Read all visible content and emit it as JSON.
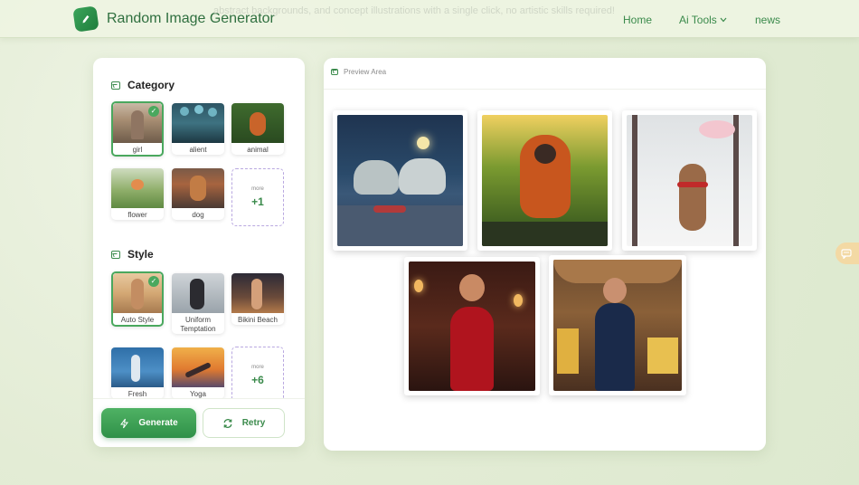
{
  "header": {
    "brand": "Random Image Generator",
    "tagline": "abstract backgrounds, and concept illustrations with a single click, no artistic skills required!",
    "nav": {
      "home": "Home",
      "ai_tools": "Ai Tools",
      "news": "news"
    }
  },
  "category": {
    "title": "Category",
    "items": [
      {
        "label": "girl",
        "selected": true
      },
      {
        "label": "alient",
        "selected": false
      },
      {
        "label": "animal",
        "selected": false
      },
      {
        "label": "flower",
        "selected": false
      },
      {
        "label": "dog",
        "selected": false
      }
    ],
    "more": {
      "label": "more",
      "count": "+1"
    }
  },
  "style": {
    "title": "Style",
    "items": [
      {
        "label": "Auto Style",
        "selected": true
      },
      {
        "label": "Uniform Temptation",
        "selected": false
      },
      {
        "label": "Bikini Beach",
        "selected": false
      },
      {
        "label": "Fresh",
        "selected": false
      },
      {
        "label": "Yoga",
        "selected": false
      }
    ],
    "more": {
      "label": "more",
      "count": "+6"
    }
  },
  "actions": {
    "generate": "Generate",
    "retry": "Retry"
  },
  "preview": {
    "title": "Preview Area",
    "images": [
      {
        "subject": "polar bears at night"
      },
      {
        "subject": "orangutan in jungle"
      },
      {
        "subject": "monkey in snow"
      },
      {
        "subject": "woman in red dress"
      },
      {
        "subject": "woman in cheese cellar"
      }
    ]
  },
  "colors": {
    "accent": "#3a8a4b",
    "accent_light": "#4fb264",
    "background": "#e3ecd5"
  }
}
